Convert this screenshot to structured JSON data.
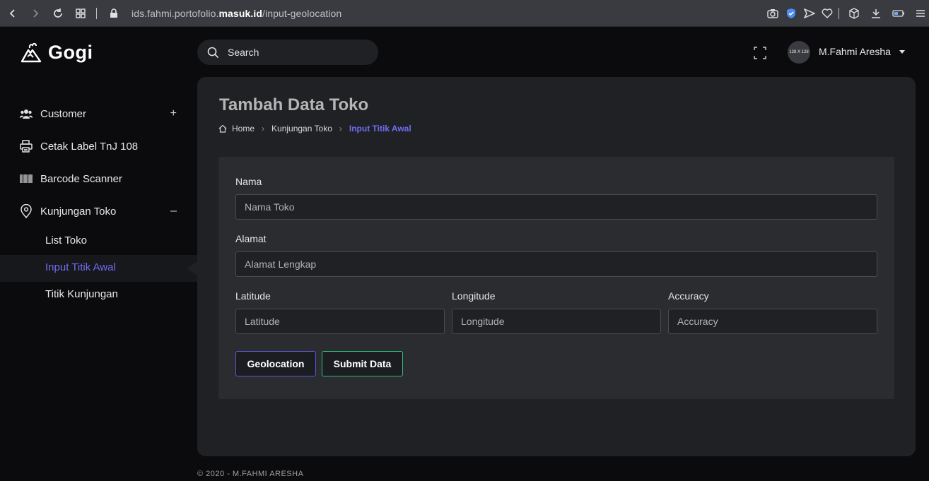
{
  "browser": {
    "url_prefix": "ids.fahmi.portofolio.",
    "url_bold": "masuk.id",
    "url_suffix": "/input-geolocation"
  },
  "sidebar": {
    "brand": "Gogi",
    "items": [
      {
        "label": "Customer",
        "toggle": "+"
      },
      {
        "label": "Cetak Label TnJ 108"
      },
      {
        "label": "Barcode Scanner"
      },
      {
        "label": "Kunjungan Toko",
        "toggle": "–"
      }
    ],
    "subitems": [
      {
        "label": "List Toko"
      },
      {
        "label": "Input Titik Awal"
      },
      {
        "label": "Titik Kunjungan"
      }
    ]
  },
  "topbar": {
    "search_label": "Search",
    "avatar_text": "128 X 128",
    "user_name": "M.Fahmi Aresha"
  },
  "page": {
    "title": "Tambah Data Toko",
    "breadcrumb": [
      "Home",
      "Kunjungan Toko",
      "Input Titik Awal"
    ]
  },
  "form": {
    "nama_label": "Nama",
    "nama_placeholder": "Nama Toko",
    "alamat_label": "Alamat",
    "alamat_placeholder": "Alamat Lengkap",
    "lat_label": "Latitude",
    "lat_placeholder": "Latitude",
    "lng_label": "Longitude",
    "lng_placeholder": "Longitude",
    "acc_label": "Accuracy",
    "acc_placeholder": "Accuracy",
    "geo_button": "Geolocation",
    "submit_button": "Submit Data"
  },
  "footer": "© 2020 - M.FAHMI ARESHA",
  "colors": {
    "accent": "#6f6cf2",
    "success": "#2fbf7a",
    "panel": "#202124",
    "card": "#2b2c30"
  }
}
